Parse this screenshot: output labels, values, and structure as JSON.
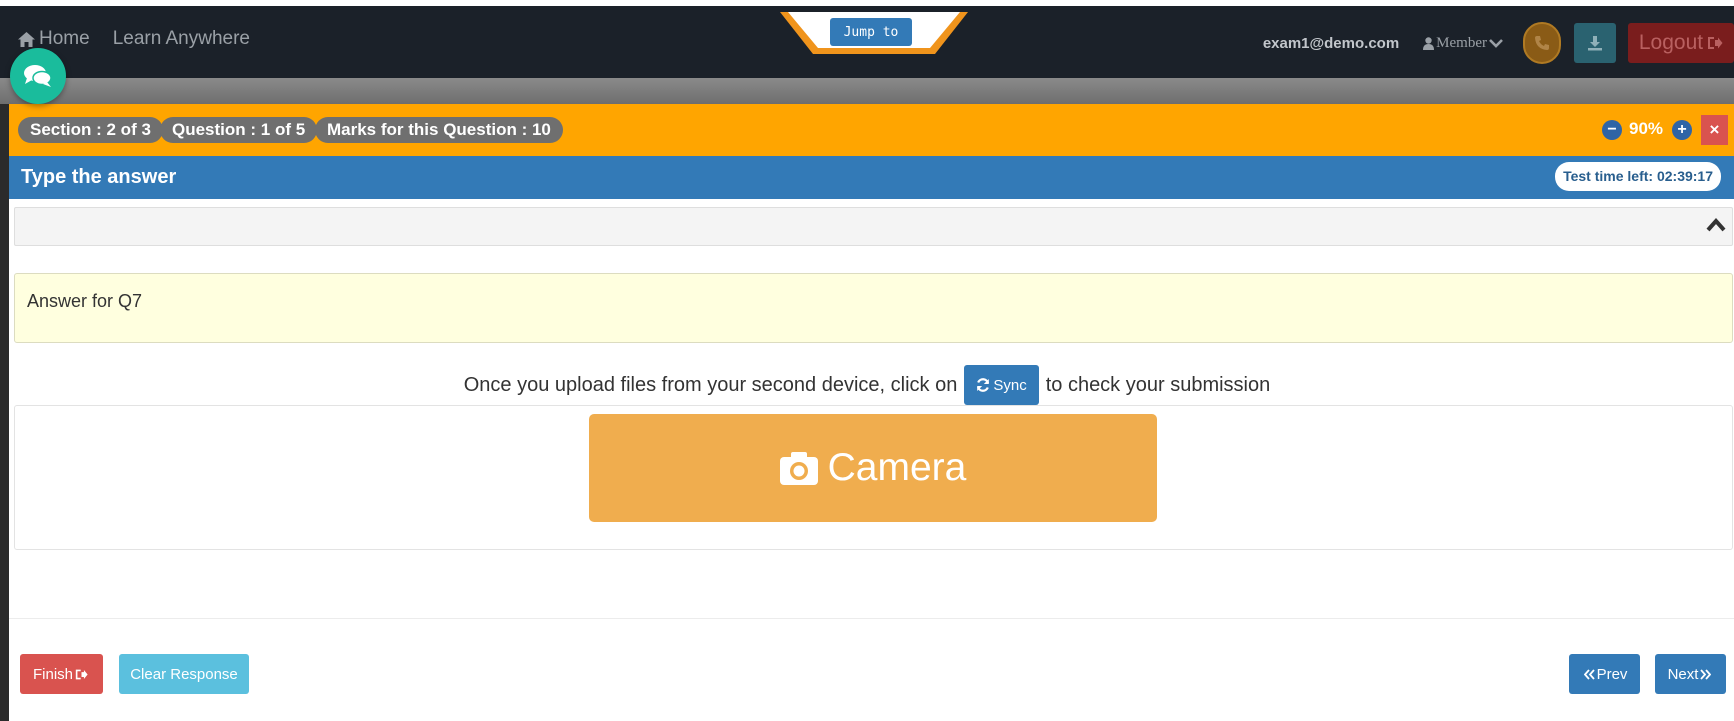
{
  "nav": {
    "home_label": "Home",
    "learn_label": "Learn Anywhere",
    "jump_label": "Jump to",
    "email": "exam1@demo.com",
    "member_label": "Member",
    "logout_label": "Logout"
  },
  "exam_bar": {
    "section": "Section : 2 of 3",
    "question": "Question : 1 of 5",
    "marks": "Marks for this Question : 10",
    "zoom": "90%",
    "close_label": "×"
  },
  "question": {
    "title": "Type the answer",
    "time_left": "Test time left: 02:39:17"
  },
  "answer": {
    "text": "Answer for Q7"
  },
  "upload": {
    "prefix": "Once you upload files from your second device, click on",
    "sync_label": "Sync",
    "suffix": "to check your submission",
    "camera_label": "Camera"
  },
  "footer": {
    "finish_label": "Finish",
    "clear_label": "Clear Response",
    "prev_label": "Prev",
    "next_label": "Next"
  },
  "colors": {
    "navbar": "#1b2129",
    "orange_bar": "#ffa500",
    "blue_bar": "#337ab7",
    "camera": "#f0ad4e",
    "danger": "#d9534f",
    "info": "#5bc0de",
    "chat": "#1abc9c"
  }
}
